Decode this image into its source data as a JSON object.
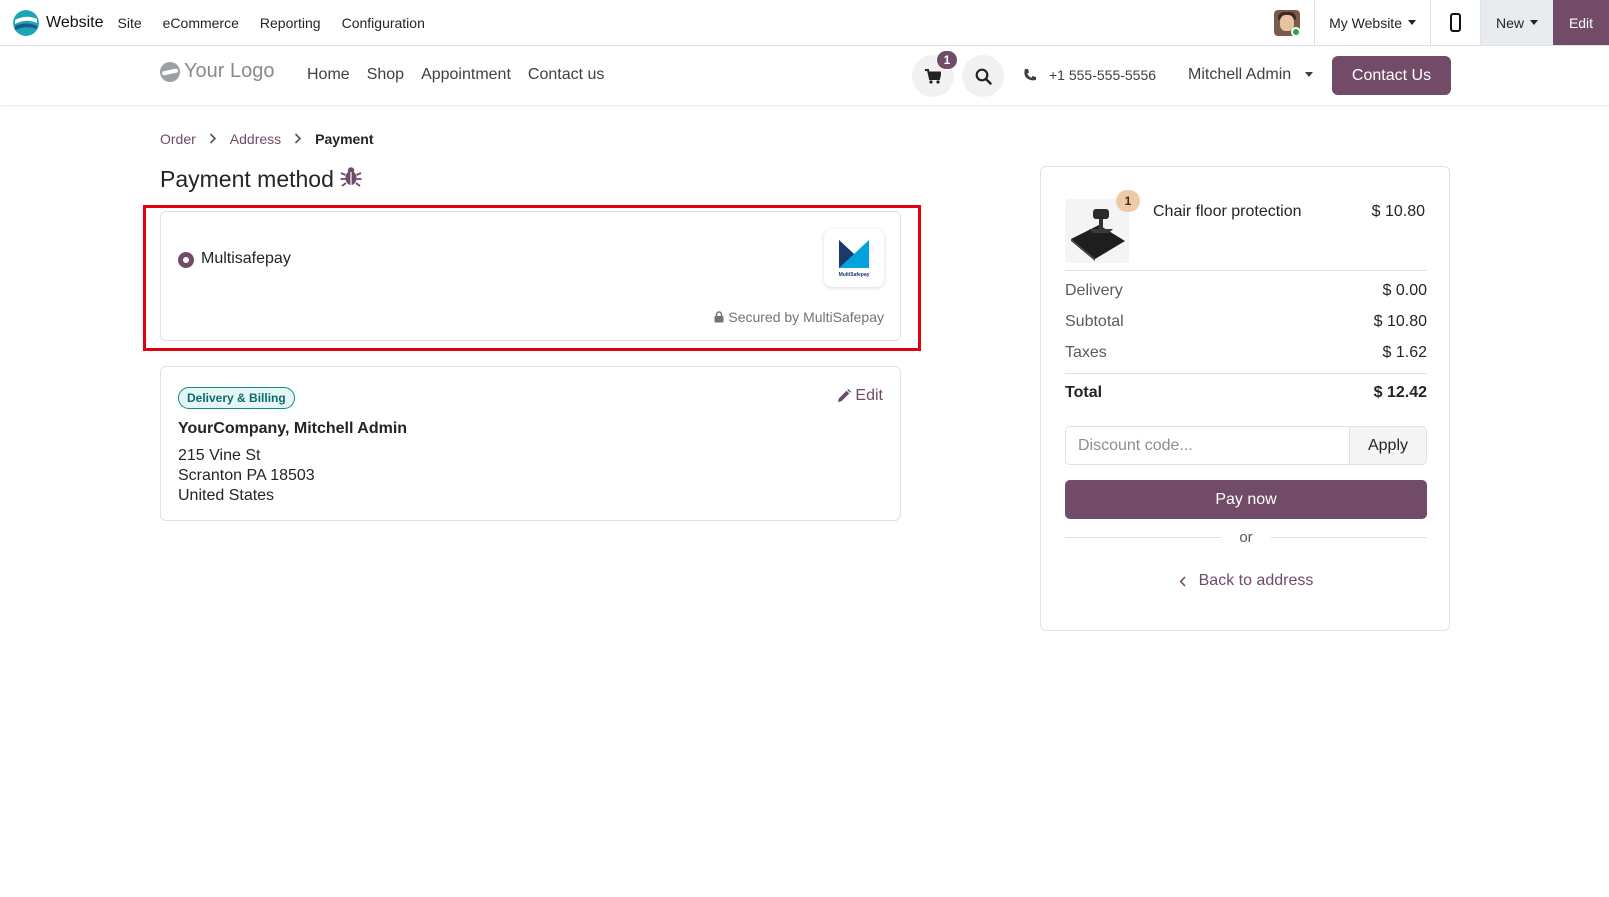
{
  "admin_bar": {
    "app_name": "Website",
    "menu": [
      "Site",
      "eCommerce",
      "Reporting",
      "Configuration"
    ],
    "website_switch": "My Website",
    "new_label": "New",
    "edit_label": "Edit"
  },
  "header": {
    "logo_text": "Your Logo",
    "nav": [
      "Home",
      "Shop",
      "Appointment",
      "Contact us"
    ],
    "cart_count": "1",
    "phone": "+1 555-555-5556",
    "user": "Mitchell Admin",
    "contact_button": "Contact Us"
  },
  "breadcrumb": {
    "items": [
      "Order",
      "Address"
    ],
    "current": "Payment"
  },
  "page": {
    "title": "Payment method"
  },
  "payment": {
    "provider": "Multisafepay",
    "secured_text": "Secured by MultiSafepay",
    "logo_caption": "MultiSafepay"
  },
  "address": {
    "badge": "Delivery & Billing",
    "edit_label": "Edit",
    "name": "YourCompany, Mitchell Admin",
    "street": "215 Vine St",
    "city": "Scranton PA 18503",
    "country": "United States"
  },
  "summary": {
    "product_name": "Chair floor protection",
    "product_qty": "1",
    "product_price": "$ 10.80",
    "delivery_label": "Delivery",
    "delivery_value": "$ 0.00",
    "subtotal_label": "Subtotal",
    "subtotal_value": "$ 10.80",
    "taxes_label": "Taxes",
    "taxes_value": "$ 1.62",
    "total_label": "Total",
    "total_value": "$ 12.42",
    "discount_placeholder": "Discount code...",
    "apply_label": "Apply",
    "pay_label": "Pay now",
    "or_label": "or",
    "back_label": "Back to address"
  },
  "colors": {
    "brand": "#714b67",
    "highlight": "#e3000f",
    "badge_teal": "#0b6b6b"
  }
}
